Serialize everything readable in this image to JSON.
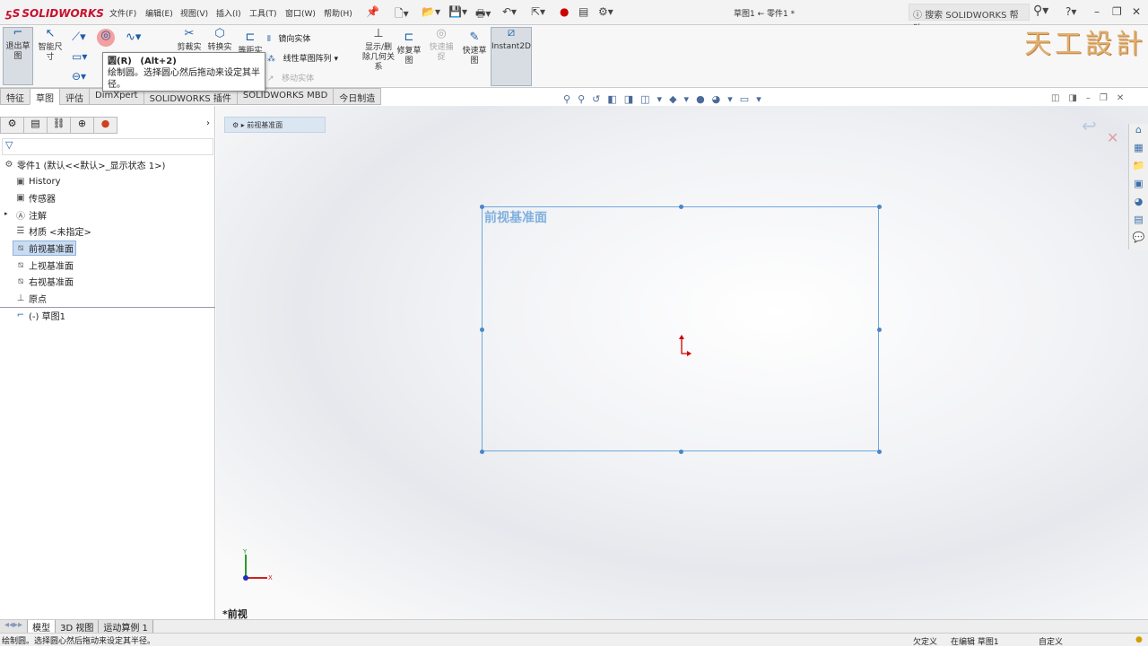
{
  "app": {
    "brand": "SOLIDWORKS",
    "doc_title": "草图1 ← 零件1 *",
    "search_placeholder": "搜索 SOLIDWORKS 帮助",
    "watermark": "天工設計"
  },
  "menu": [
    "文件(F)",
    "编辑(E)",
    "视图(V)",
    "插入(I)",
    "工具(T)",
    "窗口(W)",
    "帮助(H)"
  ],
  "ribbon": {
    "exit_sketch": "退出草图",
    "smart_dim": "智能尺寸",
    "trim": "剪裁实",
    "convert": "转换实",
    "offset": "等距实",
    "mirror": "镜向实体",
    "linear_pattern": "线性草图阵列",
    "move": "移动实体",
    "show_relations": "显示/删除几何关系",
    "repair": "修复草图",
    "quick_snap": "快速捕捉",
    "rapid_sketch": "快速草图",
    "instant2d": "Instant2D"
  },
  "tooltip": {
    "title": "圆(R)",
    "shortcut": "(Alt+2)",
    "body": "绘制圆。选择圆心然后拖动来设定其半径。"
  },
  "tabs": [
    {
      "label": "特征"
    },
    {
      "label": "草图",
      "selected": true
    },
    {
      "label": "评估"
    },
    {
      "label": "DimXpert"
    },
    {
      "label": "SOLIDWORKS 插件"
    },
    {
      "label": "SOLIDWORKS MBD"
    },
    {
      "label": "今日制造"
    }
  ],
  "tree": {
    "root": "零件1 (默认<<默认>_显示状态 1>)",
    "items": [
      {
        "label": "History",
        "icon": "history-folder-icon"
      },
      {
        "label": "传感器",
        "icon": "sensor-folder-icon"
      },
      {
        "label": "注解",
        "icon": "annotation-folder-icon"
      },
      {
        "label": "材质 <未指定>",
        "icon": "material-icon"
      },
      {
        "label": "前视基准面",
        "icon": "plane-icon",
        "selected": true
      },
      {
        "label": "上视基准面",
        "icon": "plane-icon"
      },
      {
        "label": "右视基准面",
        "icon": "plane-icon"
      },
      {
        "label": "原点",
        "icon": "origin-icon"
      },
      {
        "label": "(-) 草图1",
        "icon": "sketch-icon"
      }
    ]
  },
  "canvas": {
    "breadcrumb": "前视基准面",
    "plane_label": "前视基准面",
    "view_label": "*前视",
    "triad_x": "X",
    "triad_y": "Y"
  },
  "bottom_tabs": [
    {
      "label": "模型",
      "selected": true
    },
    {
      "label": "3D 视图"
    },
    {
      "label": "运动算例 1"
    }
  ],
  "status": {
    "message": "绘制圆。选择圆心然后拖动来设定其半径。",
    "defined": "欠定义",
    "editing": "在编辑 草图1",
    "units": "自定义"
  },
  "colors": {
    "accent": "#1b5ea8",
    "sketch": "#6fa8dc",
    "origin": "#d00000"
  }
}
